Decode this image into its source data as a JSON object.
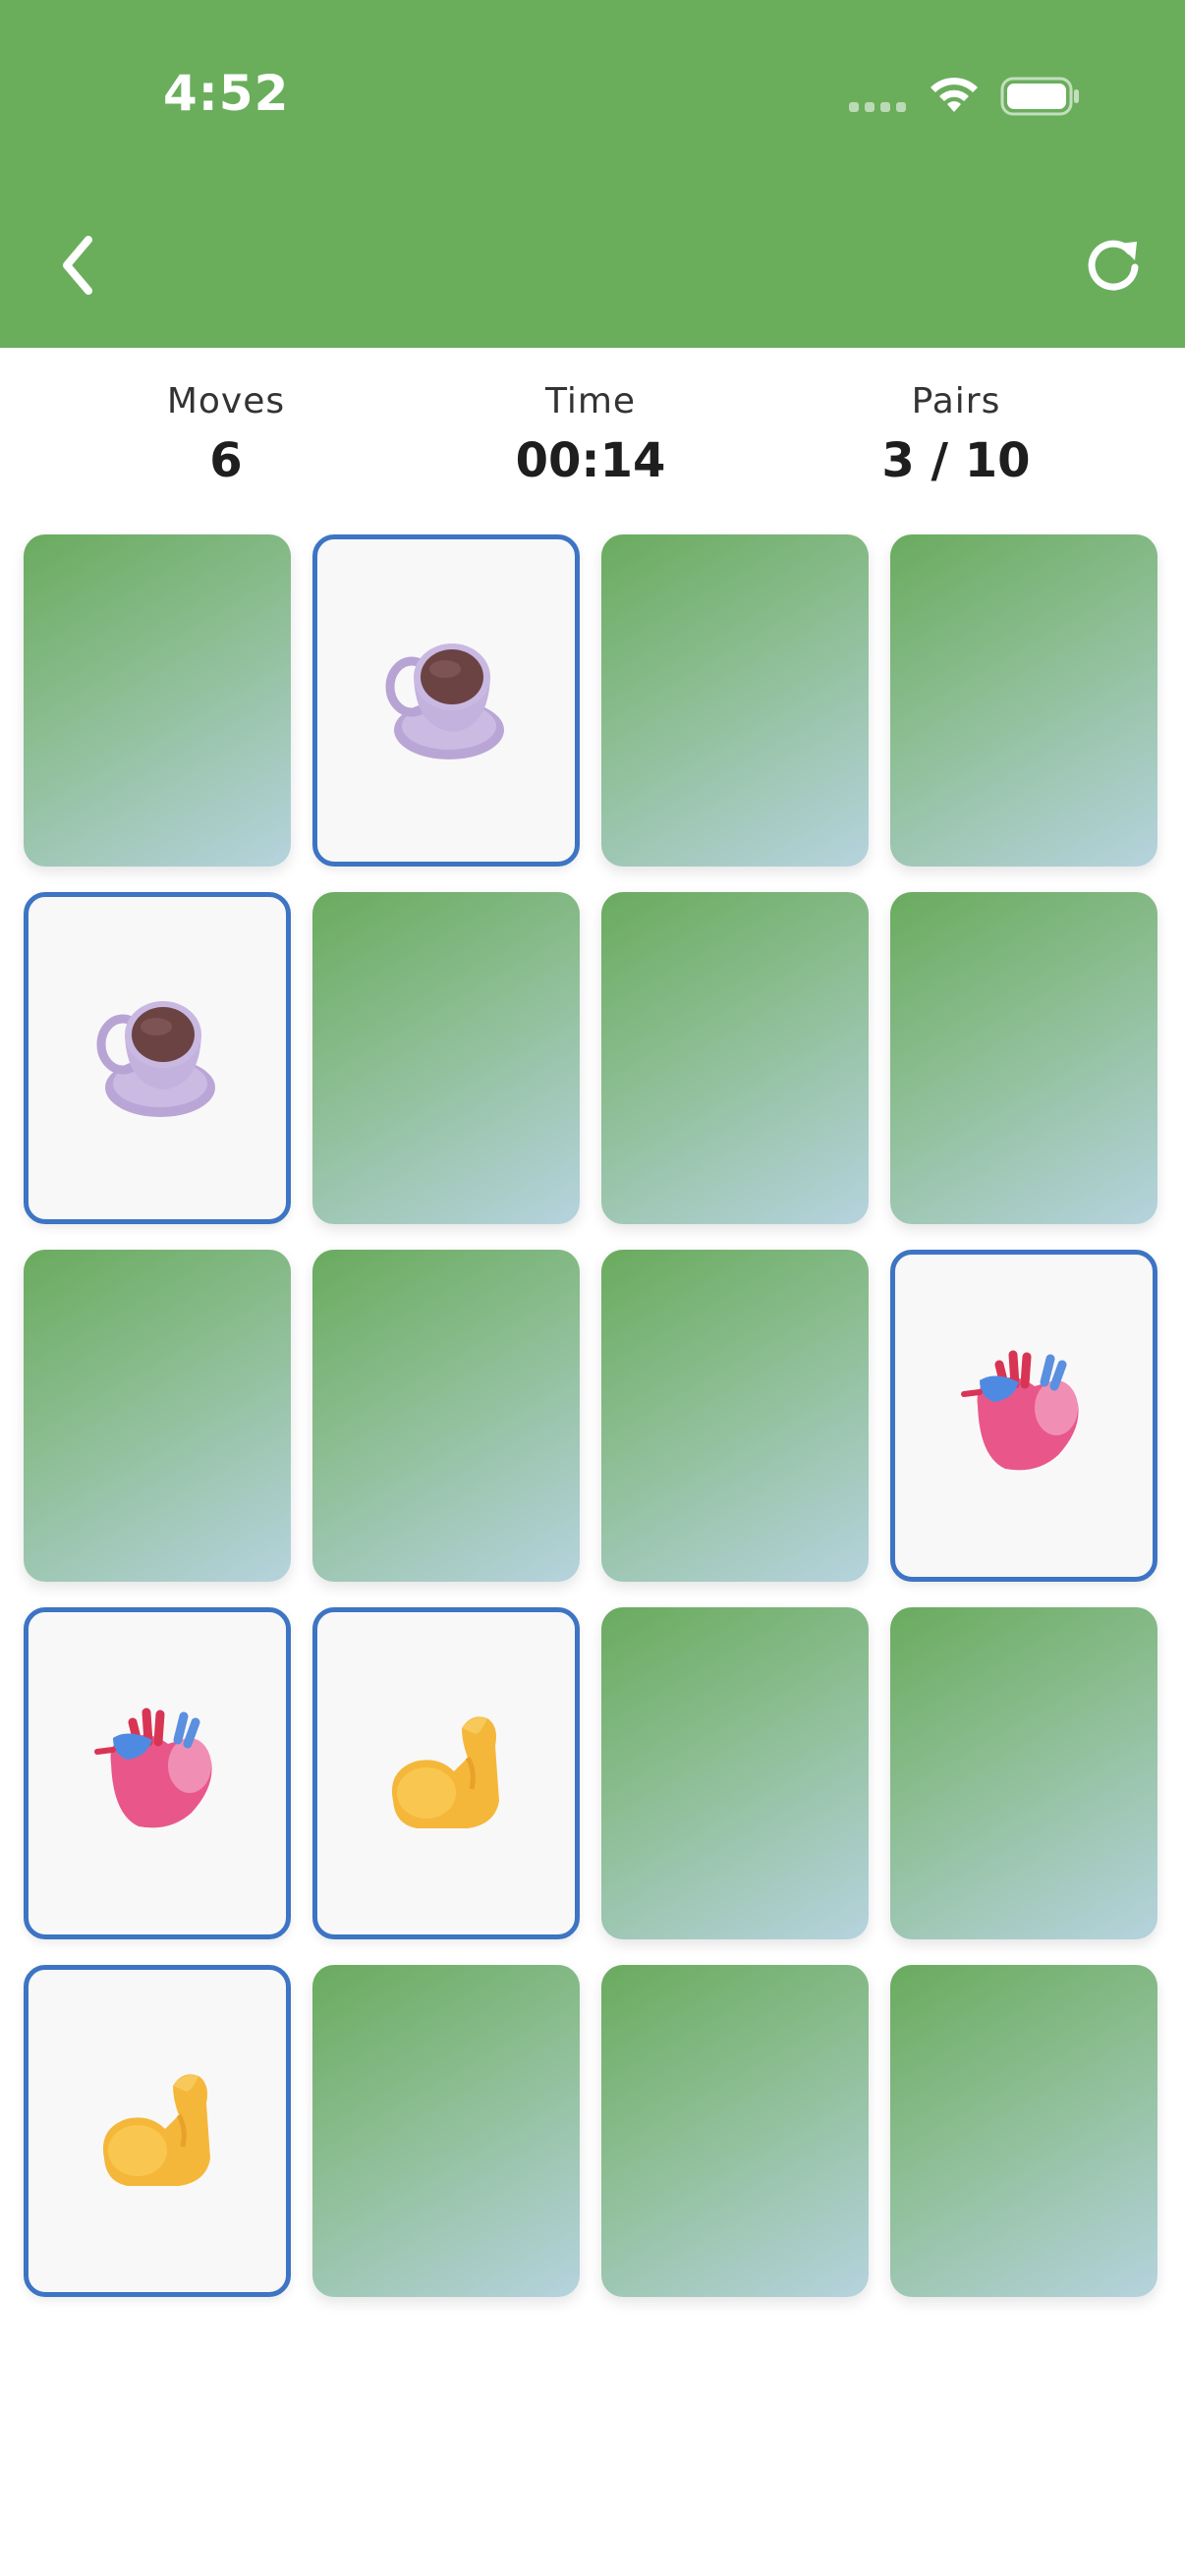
{
  "status_bar": {
    "time": "4:52"
  },
  "header": {
    "back_icon": "chevron-left-icon",
    "refresh_icon": "refresh-icon",
    "color": "#6aae5c"
  },
  "stats": [
    {
      "label": "Moves",
      "value": "6"
    },
    {
      "label": "Time",
      "value": "00:14"
    },
    {
      "label": "Pairs",
      "value": "3 / 10"
    }
  ],
  "board": {
    "columns": 4,
    "rows": 5,
    "face_up_border_color": "#3d74c4",
    "cards": [
      {
        "state": "down",
        "icon": ""
      },
      {
        "state": "up",
        "icon": "coffee-cup-icon"
      },
      {
        "state": "down",
        "icon": ""
      },
      {
        "state": "down",
        "icon": ""
      },
      {
        "state": "up",
        "icon": "coffee-cup-icon"
      },
      {
        "state": "down",
        "icon": ""
      },
      {
        "state": "down",
        "icon": ""
      },
      {
        "state": "down",
        "icon": ""
      },
      {
        "state": "down",
        "icon": ""
      },
      {
        "state": "down",
        "icon": ""
      },
      {
        "state": "down",
        "icon": ""
      },
      {
        "state": "up",
        "icon": "anatomical-heart-icon"
      },
      {
        "state": "up",
        "icon": "anatomical-heart-icon"
      },
      {
        "state": "up",
        "icon": "flexed-biceps-icon"
      },
      {
        "state": "down",
        "icon": ""
      },
      {
        "state": "down",
        "icon": ""
      },
      {
        "state": "up",
        "icon": "flexed-biceps-icon"
      },
      {
        "state": "down",
        "icon": ""
      },
      {
        "state": "down",
        "icon": ""
      },
      {
        "state": "down",
        "icon": ""
      }
    ]
  }
}
